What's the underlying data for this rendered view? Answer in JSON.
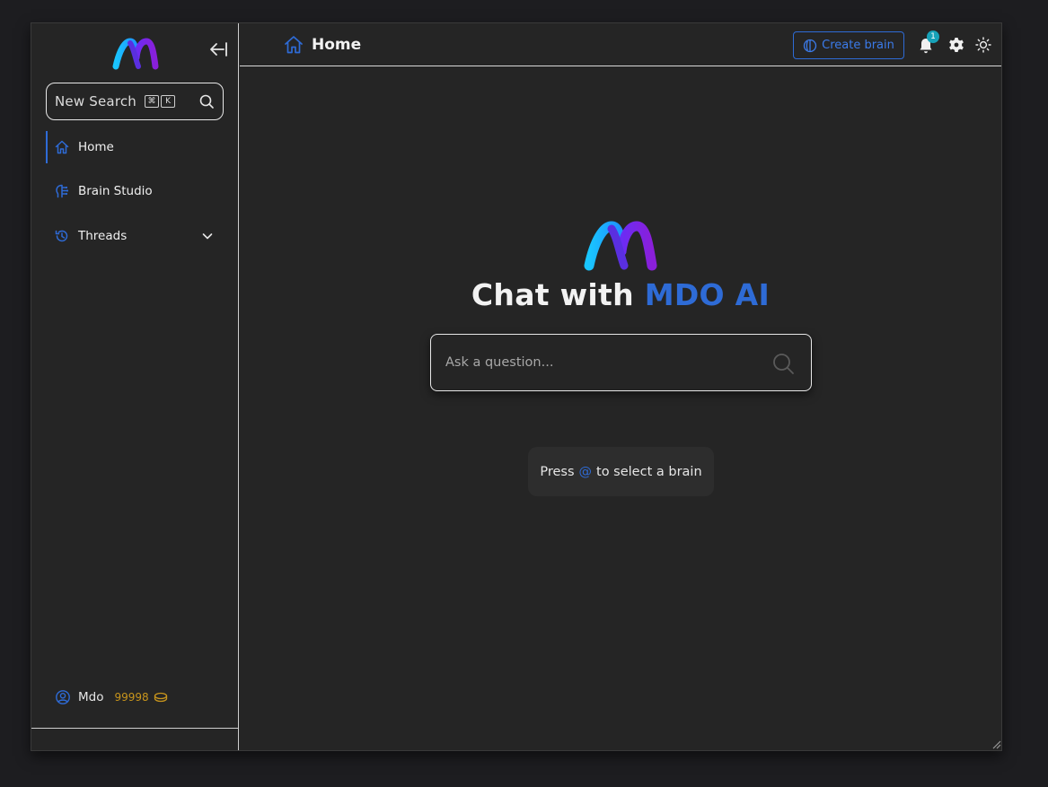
{
  "sidebar": {
    "search": {
      "label": "New Search",
      "shortcut_keys": [
        "⌘",
        "K"
      ]
    },
    "items": [
      {
        "label": "Home",
        "icon": "home-icon",
        "active": true
      },
      {
        "label": "Brain Studio",
        "icon": "brain-studio-icon",
        "active": false
      },
      {
        "label": "Threads",
        "icon": "history-icon",
        "active": false
      }
    ],
    "user": {
      "name": "Mdo",
      "credits": "99998"
    }
  },
  "topbar": {
    "page_title": "Home",
    "create_brain_label": "Create brain",
    "notification_count": "1"
  },
  "hero": {
    "title_prefix": "Chat with",
    "title_accent": "MDO AI"
  },
  "chat": {
    "placeholder": "Ask a question...",
    "hint_prefix": "Press",
    "hint_key": "@",
    "hint_suffix": "to select a brain"
  },
  "colors": {
    "accent": "#2e6bd6",
    "background": "#252525",
    "credits": "#c8951c",
    "badge": "#17a2b8"
  }
}
